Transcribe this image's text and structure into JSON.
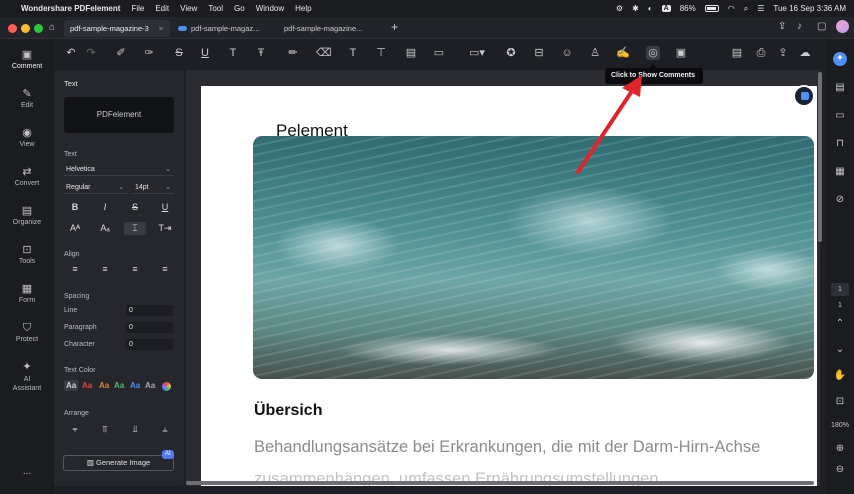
{
  "menubar": {
    "app_name": "Wondershare PDFelement",
    "items": [
      "File",
      "Edit",
      "View",
      "Tool",
      "Go",
      "Window",
      "Help"
    ],
    "battery": "86%",
    "input_source": "A",
    "clock": "Tue 16 Sep  3:36 AM"
  },
  "tabs": [
    {
      "label": "pdf-sample-magazine-3",
      "active": true
    },
    {
      "label": "pdf-sample-magaz...",
      "active": false,
      "cloud": true
    },
    {
      "label": "pdf-sample-magazine...",
      "active": false
    }
  ],
  "new_tab_label": "+",
  "left_nav": [
    "Comment",
    "Edit",
    "View",
    "Convert",
    "Organize",
    "Tools",
    "Form",
    "Protect",
    "AI Assistant"
  ],
  "left_nav_more": "...",
  "panel": {
    "title": "Text",
    "preview_text": "PDFelement",
    "text_section": "Text",
    "font_family": "Helvetica",
    "font_style": "Regular",
    "font_size": "14pt",
    "style_buttons": [
      "B",
      "I",
      "S",
      "U"
    ],
    "align_label": "Align",
    "spacing_label": "Spacing",
    "line_label": "Line",
    "line_value": "0",
    "paragraph_label": "Paragraph",
    "paragraph_value": "0",
    "character_label": "Character",
    "character_value": "0",
    "text_color_label": "Text Color",
    "color_swatch_text": "Aa",
    "arrange_label": "Arrange",
    "generate_button": "Generate Image",
    "ai_badge": "AI"
  },
  "tooltip": "Click to Show Comments",
  "document": {
    "title_partial": "Pelement",
    "heading": "Übersich",
    "body_line1": "Behandlungsansätze bei Erkrankungen, die mit der Darm-Hirn-Achse",
    "body_line2": "zusammenhängen, umfassen Ernährungsumstellungen"
  },
  "right_rail": {
    "page_number": "1",
    "page_total": "1",
    "zoom": "180%"
  },
  "colors": {
    "accent": "#4d8df5",
    "arrow": "#e0242b",
    "swatches": [
      "#cfcfd4",
      "#e0453a",
      "#e8823a",
      "#4fb86a",
      "#4d8df5",
      "#a7a9ae"
    ]
  }
}
